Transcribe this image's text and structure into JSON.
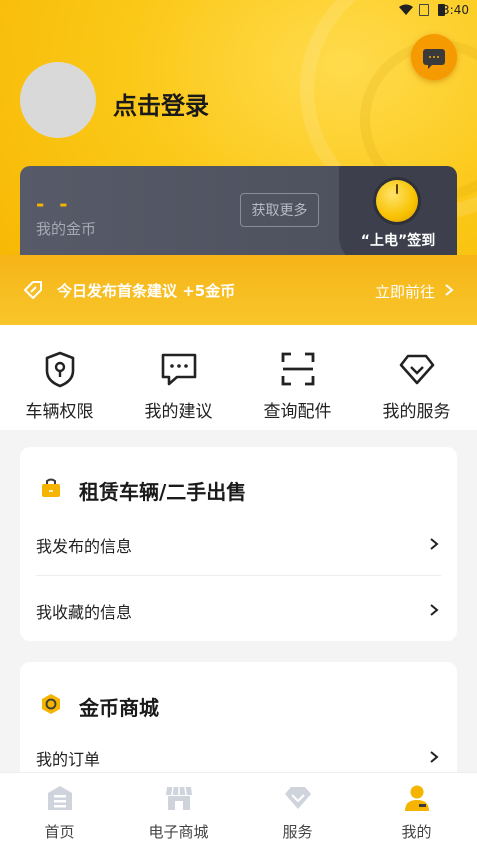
{
  "status_bar": {
    "time": "3:40"
  },
  "profile": {
    "login_text": "点击登录"
  },
  "coins": {
    "value": "- -",
    "label": "我的金币",
    "get_more": "获取更多",
    "signin": "“上电”签到"
  },
  "suggest": {
    "text": "今日发布首条建议 +5金币",
    "action": "立即前往"
  },
  "quick_menu": [
    {
      "label": "车辆权限",
      "icon": "shield-location-icon"
    },
    {
      "label": "我的建议",
      "icon": "message-icon"
    },
    {
      "label": "查询配件",
      "icon": "scan-icon"
    },
    {
      "label": "我的服务",
      "icon": "diamond-icon"
    }
  ],
  "rental": {
    "title": "租赁车辆/二手出售",
    "icon": "shopping-bag-icon",
    "rows": [
      {
        "label": "我发布的信息"
      },
      {
        "label": "我收藏的信息"
      }
    ]
  },
  "coin_mall": {
    "title": "金币商城",
    "icon": "coin-icon",
    "rows": [
      {
        "label": "我的订单"
      }
    ]
  },
  "bottom_nav": [
    {
      "label": "首页",
      "icon": "home-icon",
      "active": false
    },
    {
      "label": "电子商城",
      "icon": "store-icon",
      "active": false
    },
    {
      "label": "服务",
      "icon": "diamond-icon",
      "active": false
    },
    {
      "label": "我的",
      "icon": "user-icon",
      "active": true
    }
  ],
  "colors": {
    "accent": "#f5b400",
    "card_dark": "#4b4e5b",
    "inactive_icon": "#cfd3dc"
  }
}
